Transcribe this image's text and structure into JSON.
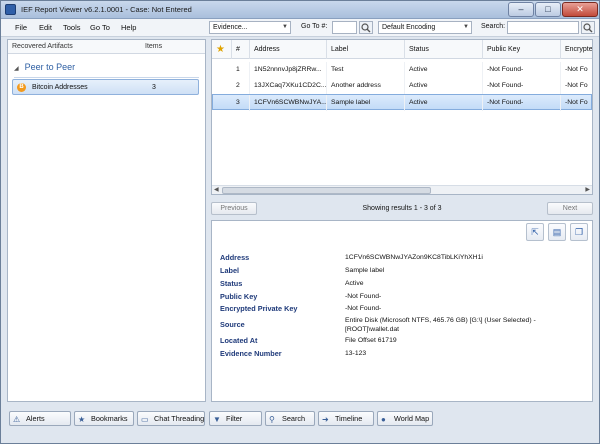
{
  "window": {
    "title": "IEF Report Viewer v6.2.1.0001 - Case: Not Entered"
  },
  "menu": [
    "File",
    "Edit",
    "Tools",
    "Go To",
    "Help"
  ],
  "toolbar": {
    "evidence_select": "Evidence...",
    "goto_label": "Go To #:",
    "encoding_select": "Default Encoding",
    "search_label": "Search:"
  },
  "left_panel": {
    "col_artifacts": "Recovered Artifacts",
    "col_items": "Items",
    "group": "Peer to Peer",
    "artifact": {
      "name": "Bitcoin Addresses",
      "count": "3"
    }
  },
  "grid": {
    "columns": [
      "#",
      "Address",
      "Label",
      "Status",
      "Public Key",
      "Encrypted"
    ],
    "rows": [
      {
        "num": "1",
        "address": "1N52nnnvJp8jZRRw...",
        "label": "Test",
        "status": "Active",
        "public_key": "-Not Found-",
        "encrypted": "-Not Fo"
      },
      {
        "num": "2",
        "address": "13JXCaq7XKu1CD2C...",
        "label": "Another address",
        "status": "Active",
        "public_key": "-Not Found-",
        "encrypted": "-Not Fo"
      },
      {
        "num": "3",
        "address": "1CFVn6SCWBNwJYA...",
        "label": "Sample label",
        "status": "Active",
        "public_key": "-Not Found-",
        "encrypted": "-Not Fo"
      }
    ],
    "selected_row": 3
  },
  "pager": {
    "previous": "Previous",
    "status": "Showing results 1 - 3 of 3",
    "next": "Next"
  },
  "detail": {
    "fields": [
      {
        "key": "Address",
        "value": "1CFVn6SCWBNwJYAZon9KC8TibLKiYhXH1i"
      },
      {
        "key": "Label",
        "value": "Sample label"
      },
      {
        "key": "Status",
        "value": "Active"
      },
      {
        "key": "Public Key",
        "value": "-Not Found-"
      },
      {
        "key": "Encrypted Private Key",
        "value": "-Not Found-"
      },
      {
        "key": "Source",
        "value": "Entire Disk (Microsoft NTFS, 465.76 GB) [G:\\] (User Selected) - [ROOT]\\wallet.dat"
      },
      {
        "key": "Located At",
        "value": "File Offset 61719"
      },
      {
        "key": "Evidence Number",
        "value": "13-123"
      }
    ]
  },
  "bottom_tabs": [
    "Alerts",
    "Bookmarks",
    "Chat Threading",
    "Filter",
    "Search",
    "Timeline",
    "World Map"
  ]
}
